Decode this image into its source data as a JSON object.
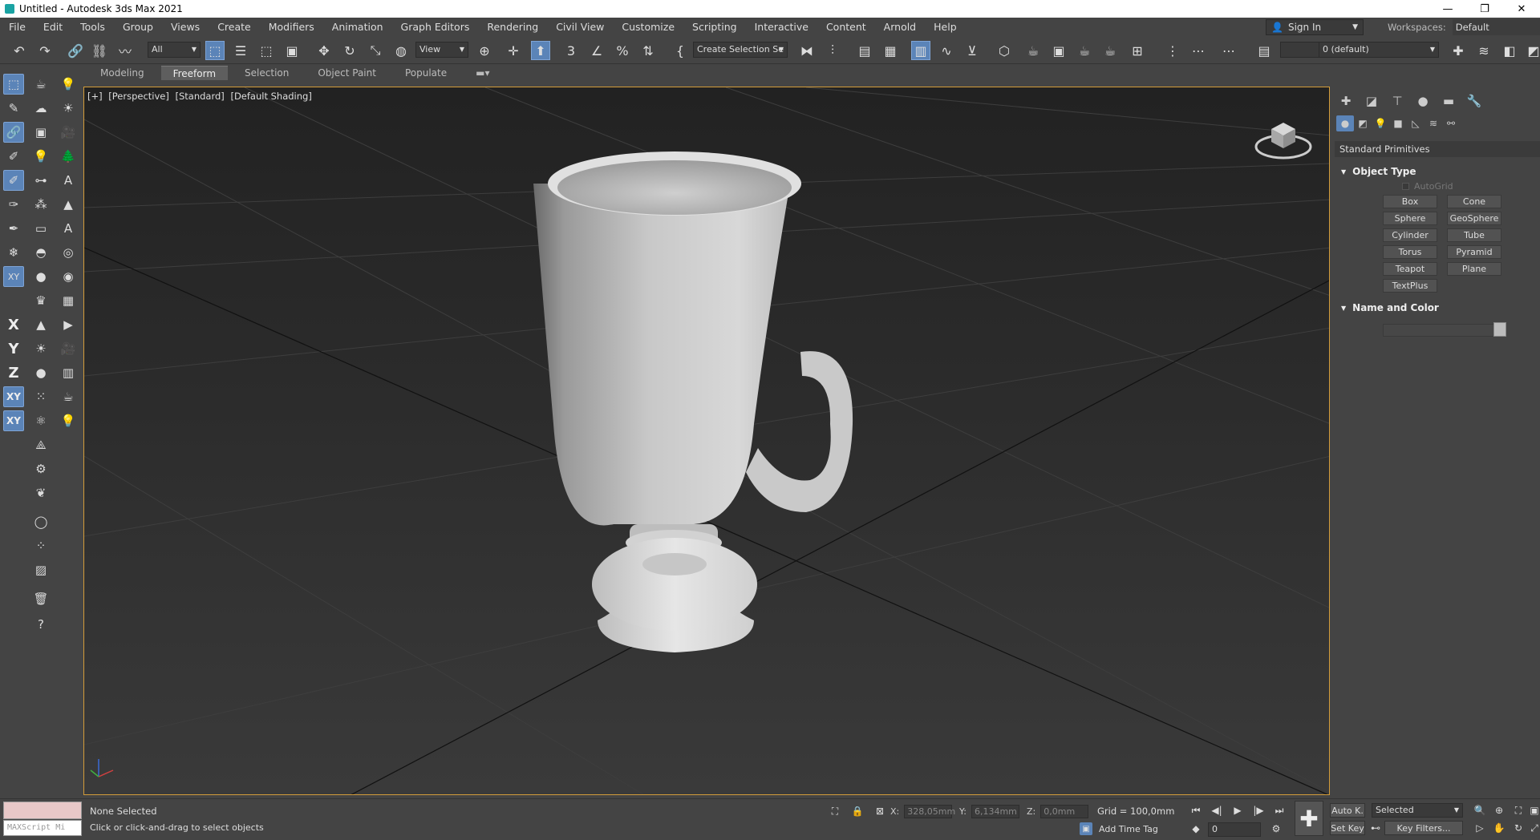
{
  "window": {
    "title": "Untitled - Autodesk 3ds Max 2021",
    "minimize": "—",
    "restore": "❐",
    "close": "✕"
  },
  "menu": [
    "File",
    "Edit",
    "Tools",
    "Group",
    "Views",
    "Create",
    "Modifiers",
    "Animation",
    "Graph Editors",
    "Rendering",
    "Civil View",
    "Customize",
    "Scripting",
    "Interactive",
    "Content",
    "Arnold",
    "Help"
  ],
  "account": {
    "sign_in": "Sign In",
    "workspaces_label": "Workspaces:",
    "workspace": "Default"
  },
  "toolbar": {
    "selection_filter": "All",
    "coord_system": "View",
    "named_selection": "Create Selection Se",
    "layer": "0 (default)"
  },
  "ribbon": {
    "tabs": [
      "Modeling",
      "Freeform",
      "Selection",
      "Object Paint",
      "Populate"
    ],
    "active": "Freeform"
  },
  "left_axis": {
    "x": "X",
    "y": "Y",
    "z": "Z",
    "xy": "XY",
    "xy2": "XY"
  },
  "viewport": {
    "labels": [
      "[+]",
      "[Perspective]",
      "[Standard]",
      "[Default Shading]"
    ]
  },
  "command_panel": {
    "category": "Standard Primitives",
    "object_type_title": "Object Type",
    "autogrid": "AutoGrid",
    "buttons": [
      "Box",
      "Cone",
      "Sphere",
      "GeoSphere",
      "Cylinder",
      "Tube",
      "Torus",
      "Pyramid",
      "Teapot",
      "Plane",
      "TextPlus"
    ],
    "name_color_title": "Name and Color"
  },
  "status": {
    "maxscript": "MAXScript Mi",
    "line1": "None Selected",
    "line2": "Click or click-and-drag to select objects",
    "x_label": "X:",
    "x_value": "328,05mm",
    "y_label": "Y:",
    "y_value": "6,134mm",
    "z_label": "Z:",
    "z_value": "0,0mm",
    "grid": "Grid = 100,0mm",
    "add_time_tag": "Add Time Tag",
    "frame": "0",
    "auto_key": "Auto K.",
    "set_key": "Set Key",
    "key_mode": "Selected",
    "key_filters": "Key Filters..."
  }
}
